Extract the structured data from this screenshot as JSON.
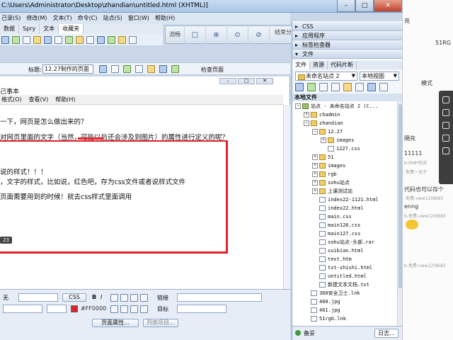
{
  "window": {
    "title": "C:\\Users\\Administrator\\Desktop\\zhandian\\untitled.html (XHTML)]",
    "controls": [
      "–",
      "□",
      "✕"
    ]
  },
  "menubar": {
    "items": [
      "己录(S)",
      "修改(M)",
      "文本(T)",
      "命令(C)",
      "站点(S)",
      "窗口(W)",
      "帮助(H)"
    ]
  },
  "insert_tabs": [
    "数据",
    "Spry",
    "文本",
    "收藏夹"
  ],
  "workspace": {
    "tabs": [
      "流畅",
      "□",
      "⊕",
      "⊙",
      "⊘"
    ],
    "right": "结束分享"
  },
  "doc_toolbar": {
    "title_label": "标题:",
    "title_value": "12.27制作的页面",
    "check_label": "检查页面"
  },
  "document": {
    "notepad_title": "己事本",
    "notepad_menu": [
      "格式(O)",
      "查看(V)",
      "帮助(H)"
    ],
    "lines": [
      "一下，网页是怎么做出来的？",
      "对网页里面的文字（当然，可能以后还会涉及到图片）的属性进行定义的呢？",
      "说的样式！！！",
      "，文字的样式，比如说，红色吧，存为css文件或者说样式文件",
      "页面需要用到的时候！就去css样式里面调用"
    ],
    "badge": "23"
  },
  "properties": {
    "font_value": "无",
    "css_button": "CSS",
    "color_value": "#FF0000",
    "link_label": "链接",
    "target_label": "目标",
    "page_props_button": "页面属性...",
    "list_item_button": "列表项目...",
    "format_bold": "B",
    "format_italic": "I"
  },
  "right_panel": {
    "css_header": "CSS",
    "app_header": "应用程序",
    "tag_header": "标签检查器",
    "files_header": "文件",
    "tabs": [
      "文件",
      "资源",
      "代码片断"
    ],
    "site_select": "未命名站点 2",
    "view_select": "本地视图",
    "local_files_header": "本地文件",
    "tree": [
      {
        "label": "站点 - 未命名站点 2 (C...",
        "depth": 0,
        "type": "site",
        "toggle": "−"
      },
      {
        "label": "chadmin",
        "depth": 1,
        "type": "folder",
        "toggle": "+"
      },
      {
        "label": "zhandian",
        "depth": 1,
        "type": "folder",
        "toggle": "−"
      },
      {
        "label": "12.27",
        "depth": 2,
        "type": "folder",
        "toggle": "−"
      },
      {
        "label": "images",
        "depth": 3,
        "type": "folder",
        "toggle": "+"
      },
      {
        "label": "1227.css",
        "depth": 3,
        "type": "file",
        "toggle": ""
      },
      {
        "label": "51",
        "depth": 2,
        "type": "folder",
        "toggle": "+"
      },
      {
        "label": "images",
        "depth": 2,
        "type": "folder",
        "toggle": "+"
      },
      {
        "label": "rgb",
        "depth": 2,
        "type": "folder",
        "toggle": "+"
      },
      {
        "label": "sohu站点",
        "depth": 2,
        "type": "folder",
        "toggle": "+"
      },
      {
        "label": "上课测试站",
        "depth": 2,
        "type": "folder",
        "toggle": "+"
      },
      {
        "label": "index22-1121.html",
        "depth": 2,
        "type": "file",
        "toggle": ""
      },
      {
        "label": "index22.html",
        "depth": 2,
        "type": "file",
        "toggle": ""
      },
      {
        "label": "main.css",
        "depth": 2,
        "type": "file",
        "toggle": ""
      },
      {
        "label": "main126.css",
        "depth": 2,
        "type": "file",
        "toggle": ""
      },
      {
        "label": "main127.css",
        "depth": 2,
        "type": "file",
        "toggle": ""
      },
      {
        "label": "sohu站点-头部.rar",
        "depth": 2,
        "type": "file",
        "toggle": ""
      },
      {
        "label": "suibian.html",
        "depth": 2,
        "type": "file",
        "toggle": ""
      },
      {
        "label": "test.htm",
        "depth": 2,
        "type": "file",
        "toggle": ""
      },
      {
        "label": "txt-shishi.html",
        "depth": 2,
        "type": "file",
        "toggle": ""
      },
      {
        "label": "untitled.html",
        "depth": 2,
        "type": "file",
        "toggle": ""
      },
      {
        "label": "新建文本文档.txt",
        "depth": 2,
        "type": "file",
        "toggle": ""
      },
      {
        "label": "360安全卫士.lnk",
        "depth": 1,
        "type": "file",
        "toggle": ""
      },
      {
        "label": "460.jpg",
        "depth": 1,
        "type": "file",
        "toggle": ""
      },
      {
        "label": "461.jpg",
        "depth": 1,
        "type": "file",
        "toggle": ""
      },
      {
        "label": "51rgb.lnk",
        "depth": 1,
        "type": "file",
        "toggle": ""
      }
    ],
    "footer_left": "备妥",
    "footer_button": "日志..."
  },
  "chat": {
    "name": "51RG",
    "lines": [
      "充",
      "模式",
      "隔充",
      "11111",
      "b-008*的充",
      "-免费一太子",
      "代码也可以存个",
      "enng",
      "b-免费-vww12(8683"
    ],
    "small": [
      "-免费-vww12(8683",
      "b-免费-vww12(8683"
    ]
  },
  "colors": {
    "accent_red": "#e0202a",
    "titlebar": "#a9c6e6"
  }
}
